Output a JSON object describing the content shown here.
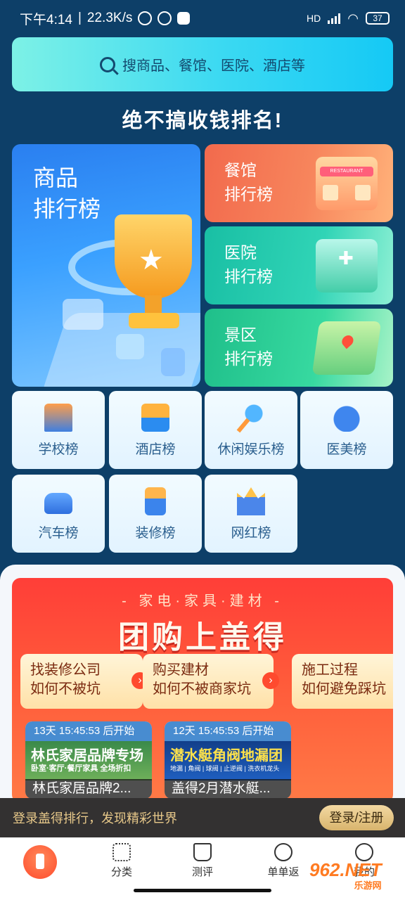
{
  "status_bar": {
    "time": "下午4:14",
    "net_speed": "22.3K/s",
    "network_type": "HD",
    "battery": "37"
  },
  "search": {
    "placeholder": "搜商品、餐馆、医院、酒店等"
  },
  "headline": "绝不搞收钱排名!",
  "cards": {
    "goods": {
      "line1": "商品",
      "line2": "排行榜"
    },
    "food": {
      "line1": "餐馆",
      "line2": "排行榜"
    },
    "hospital": {
      "line1": "医院",
      "line2": "排行榜"
    },
    "scenic": {
      "line1": "景区",
      "line2": "排行榜"
    }
  },
  "restaurant_sign": "RESTAURANT",
  "tiles": [
    {
      "label": "学校榜",
      "icon": "school-icon"
    },
    {
      "label": "酒店榜",
      "icon": "hotel-icon"
    },
    {
      "label": "休闲娱乐榜",
      "icon": "microphone-icon"
    },
    {
      "label": "医美榜",
      "icon": "face-icon"
    },
    {
      "label": "汽车榜",
      "icon": "car-icon"
    },
    {
      "label": "装修榜",
      "icon": "paint-brush-icon"
    },
    {
      "label": "网红榜",
      "icon": "crown-icon"
    }
  ],
  "promo": {
    "subtitle": "- 家电·家具·建材 -",
    "title": "团购上盖得",
    "chips": [
      {
        "line1": "找装修公司",
        "line2": "如何不被坑"
      },
      {
        "line1": "购买建材",
        "line2": "如何不被商家坑"
      },
      {
        "line1": "施工过程",
        "line2": "如何避免踩坑"
      }
    ],
    "deals": [
      {
        "time": "13天 15:45:53 后开始",
        "banner": "林氏家居品牌专场",
        "banner_sub": "卧室·客厅·餐厅家具 全场折扣",
        "caption": "林氏家居品牌2..."
      },
      {
        "time": "12天 15:45:53 后开始",
        "banner": "潜水艇角阀地漏团",
        "banner_sub": "地漏 | 角阀 | 球阀 | 止逆阀 | 洗衣机龙头",
        "caption": "盖得2月潜水艇..."
      }
    ]
  },
  "login_bar": {
    "message": "登录盖得排行，发现精彩世界",
    "button": "登录/注册"
  },
  "bottom_nav": [
    {
      "label": "",
      "icon": "home-icon"
    },
    {
      "label": "分类",
      "icon": "category-icon"
    },
    {
      "label": "测评",
      "icon": "flask-icon"
    },
    {
      "label": "单单返",
      "icon": "coins-icon"
    },
    {
      "label": "我的",
      "icon": "profile-icon"
    }
  ],
  "watermark": {
    "brand": "962.NET",
    "sub": "乐游网"
  },
  "colors": {
    "background": "#0d3f68",
    "accent": "#ff4a2c",
    "gold": "#d8b46d"
  }
}
